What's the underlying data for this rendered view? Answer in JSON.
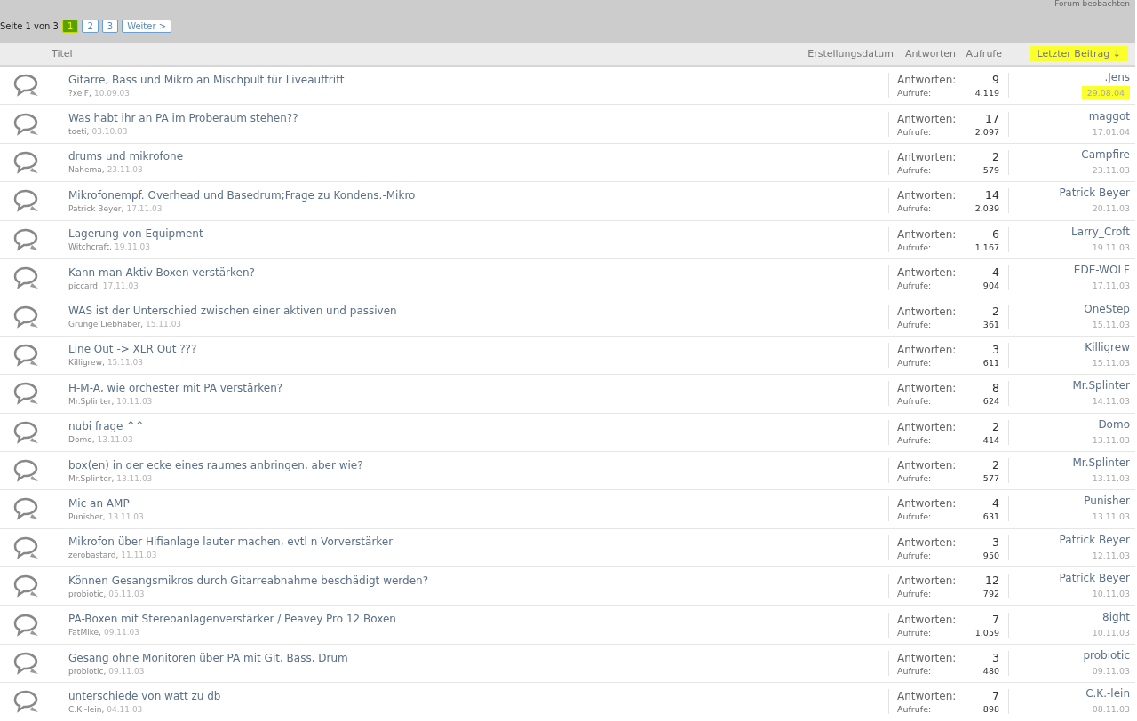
{
  "watch_link": "Forum beobachten",
  "pagination": {
    "label": "Seite 1 von 3",
    "pages": [
      {
        "label": "1",
        "selected": true
      },
      {
        "label": "2",
        "selected": false
      },
      {
        "label": "3",
        "selected": false
      }
    ],
    "next": "Weiter >"
  },
  "columns": [
    {
      "label": "Titel",
      "highlighted": false
    },
    {
      "label": "Erstellungsdatum",
      "highlighted": false
    },
    {
      "label": "Antworten",
      "highlighted": false
    },
    {
      "label": "Aufrufe",
      "highlighted": false
    },
    {
      "label": "Letzter Beitrag ↓",
      "highlighted": true
    }
  ],
  "threads": [
    {
      "title": "Gitarre, Bass und Mikro an Mischpult für Liveauftritt",
      "author": "?xelF,",
      "created": "10.09.03",
      "replies_label": "Antworten:",
      "replies": "9",
      "views_label": "Aufrufe:",
      "views": "4.119",
      "last_user": ".Jens",
      "last_date": "29.08.04",
      "highlighted": true
    },
    {
      "title": "Was habt ihr an PA im Proberaum stehen??",
      "author": "toeti,",
      "created": "03.10.03",
      "replies_label": "Antworten:",
      "replies": "17",
      "views_label": "Aufrufe:",
      "views": "2.097",
      "last_user": "maggot",
      "last_date": "17.01.04",
      "highlighted": false
    },
    {
      "title": "drums und mikrofone",
      "author": "Nahema,",
      "created": "23.11.03",
      "replies_label": "Antworten:",
      "replies": "2",
      "views_label": "Aufrufe:",
      "views": "579",
      "last_user": "Campfire",
      "last_date": "23.11.03",
      "highlighted": false
    },
    {
      "title": "Mikrofonempf. Overhead und Basedrum;Frage zu Kondens.-Mikro",
      "author": "Patrick Beyer,",
      "created": "17.11.03",
      "replies_label": "Antworten:",
      "replies": "14",
      "views_label": "Aufrufe:",
      "views": "2.039",
      "last_user": "Patrick Beyer",
      "last_date": "20.11.03",
      "highlighted": false
    },
    {
      "title": "Lagerung von Equipment",
      "author": "Witchcraft,",
      "created": "19.11.03",
      "replies_label": "Antworten:",
      "replies": "6",
      "views_label": "Aufrufe:",
      "views": "1.167",
      "last_user": "Larry_Croft",
      "last_date": "19.11.03",
      "highlighted": false
    },
    {
      "title": "Kann man Aktiv Boxen verstärken?",
      "author": "piccard,",
      "created": "17.11.03",
      "replies_label": "Antworten:",
      "replies": "4",
      "views_label": "Aufrufe:",
      "views": "904",
      "last_user": "EDE-WOLF",
      "last_date": "17.11.03",
      "highlighted": false
    },
    {
      "title": "WAS ist der Unterschied zwischen einer aktiven und passiven",
      "author": "Grunge Liebhaber,",
      "created": "15.11.03",
      "replies_label": "Antworten:",
      "replies": "2",
      "views_label": "Aufrufe:",
      "views": "361",
      "last_user": "OneStep",
      "last_date": "15.11.03",
      "highlighted": false
    },
    {
      "title": "Line Out -> XLR Out ???",
      "author": "Killigrew,",
      "created": "15.11.03",
      "replies_label": "Antworten:",
      "replies": "3",
      "views_label": "Aufrufe:",
      "views": "611",
      "last_user": "Killigrew",
      "last_date": "15.11.03",
      "highlighted": false
    },
    {
      "title": "H-M-A, wie orchester mit PA verstärken?",
      "author": "Mr.Splinter,",
      "created": "10.11.03",
      "replies_label": "Antworten:",
      "replies": "8",
      "views_label": "Aufrufe:",
      "views": "624",
      "last_user": "Mr.Splinter",
      "last_date": "14.11.03",
      "highlighted": false
    },
    {
      "title": "nubi frage ^^",
      "author": "Domo,",
      "created": "13.11.03",
      "replies_label": "Antworten:",
      "replies": "2",
      "views_label": "Aufrufe:",
      "views": "414",
      "last_user": "Domo",
      "last_date": "13.11.03",
      "highlighted": false
    },
    {
      "title": "box(en) in der ecke eines raumes anbringen, aber wie?",
      "author": "Mr.Splinter,",
      "created": "13.11.03",
      "replies_label": "Antworten:",
      "replies": "2",
      "views_label": "Aufrufe:",
      "views": "577",
      "last_user": "Mr.Splinter",
      "last_date": "13.11.03",
      "highlighted": false
    },
    {
      "title": "Mic an AMP",
      "author": "Punisher,",
      "created": "13.11.03",
      "replies_label": "Antworten:",
      "replies": "4",
      "views_label": "Aufrufe:",
      "views": "631",
      "last_user": "Punisher",
      "last_date": "13.11.03",
      "highlighted": false
    },
    {
      "title": "Mikrofon über Hifianlage lauter machen, evtl n Vorverstärker",
      "author": "zerobastard,",
      "created": "11.11.03",
      "replies_label": "Antworten:",
      "replies": "3",
      "views_label": "Aufrufe:",
      "views": "950",
      "last_user": "Patrick Beyer",
      "last_date": "12.11.03",
      "highlighted": false
    },
    {
      "title": "Können Gesangsmikros durch Gitarreabnahme beschädigt werden?",
      "author": "probiotic,",
      "created": "05.11.03",
      "replies_label": "Antworten:",
      "replies": "12",
      "views_label": "Aufrufe:",
      "views": "792",
      "last_user": "Patrick Beyer",
      "last_date": "10.11.03",
      "highlighted": false
    },
    {
      "title": "PA-Boxen mit Stereoanlagenverstärker / Peavey Pro 12 Boxen",
      "author": "FatMike,",
      "created": "09.11.03",
      "replies_label": "Antworten:",
      "replies": "7",
      "views_label": "Aufrufe:",
      "views": "1.059",
      "last_user": "8ight",
      "last_date": "10.11.03",
      "highlighted": false
    },
    {
      "title": "Gesang ohne Monitoren über PA mit Git, Bass, Drum",
      "author": "probiotic,",
      "created": "09.11.03",
      "replies_label": "Antworten:",
      "replies": "3",
      "views_label": "Aufrufe:",
      "views": "480",
      "last_user": "probiotic",
      "last_date": "09.11.03",
      "highlighted": false
    },
    {
      "title": "unterschiede von watt zu db",
      "author": "C.K.-lein,",
      "created": "04.11.03",
      "replies_label": "Antworten:",
      "replies": "7",
      "views_label": "Aufrufe:",
      "views": "898",
      "last_user": "C.K.-lein",
      "last_date": "08.11.03",
      "highlighted": false
    }
  ]
}
